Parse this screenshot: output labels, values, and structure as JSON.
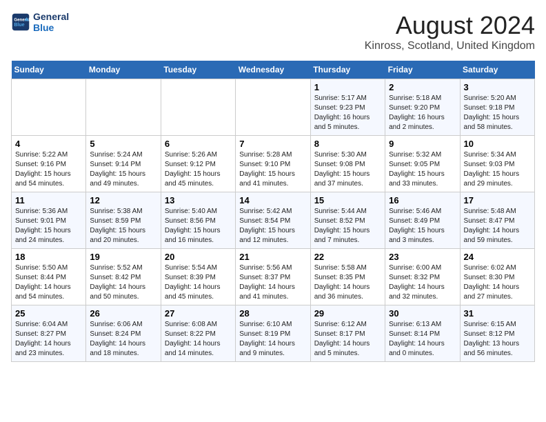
{
  "header": {
    "logo_line1": "General",
    "logo_line2": "Blue",
    "main_title": "August 2024",
    "subtitle": "Kinross, Scotland, United Kingdom"
  },
  "days_of_week": [
    "Sunday",
    "Monday",
    "Tuesday",
    "Wednesday",
    "Thursday",
    "Friday",
    "Saturday"
  ],
  "weeks": [
    [
      {
        "day": "",
        "info": ""
      },
      {
        "day": "",
        "info": ""
      },
      {
        "day": "",
        "info": ""
      },
      {
        "day": "",
        "info": ""
      },
      {
        "day": "1",
        "info": "Sunrise: 5:17 AM\nSunset: 9:23 PM\nDaylight: 16 hours\nand 5 minutes."
      },
      {
        "day": "2",
        "info": "Sunrise: 5:18 AM\nSunset: 9:20 PM\nDaylight: 16 hours\nand 2 minutes."
      },
      {
        "day": "3",
        "info": "Sunrise: 5:20 AM\nSunset: 9:18 PM\nDaylight: 15 hours\nand 58 minutes."
      }
    ],
    [
      {
        "day": "4",
        "info": "Sunrise: 5:22 AM\nSunset: 9:16 PM\nDaylight: 15 hours\nand 54 minutes."
      },
      {
        "day": "5",
        "info": "Sunrise: 5:24 AM\nSunset: 9:14 PM\nDaylight: 15 hours\nand 49 minutes."
      },
      {
        "day": "6",
        "info": "Sunrise: 5:26 AM\nSunset: 9:12 PM\nDaylight: 15 hours\nand 45 minutes."
      },
      {
        "day": "7",
        "info": "Sunrise: 5:28 AM\nSunset: 9:10 PM\nDaylight: 15 hours\nand 41 minutes."
      },
      {
        "day": "8",
        "info": "Sunrise: 5:30 AM\nSunset: 9:08 PM\nDaylight: 15 hours\nand 37 minutes."
      },
      {
        "day": "9",
        "info": "Sunrise: 5:32 AM\nSunset: 9:05 PM\nDaylight: 15 hours\nand 33 minutes."
      },
      {
        "day": "10",
        "info": "Sunrise: 5:34 AM\nSunset: 9:03 PM\nDaylight: 15 hours\nand 29 minutes."
      }
    ],
    [
      {
        "day": "11",
        "info": "Sunrise: 5:36 AM\nSunset: 9:01 PM\nDaylight: 15 hours\nand 24 minutes."
      },
      {
        "day": "12",
        "info": "Sunrise: 5:38 AM\nSunset: 8:59 PM\nDaylight: 15 hours\nand 20 minutes."
      },
      {
        "day": "13",
        "info": "Sunrise: 5:40 AM\nSunset: 8:56 PM\nDaylight: 15 hours\nand 16 minutes."
      },
      {
        "day": "14",
        "info": "Sunrise: 5:42 AM\nSunset: 8:54 PM\nDaylight: 15 hours\nand 12 minutes."
      },
      {
        "day": "15",
        "info": "Sunrise: 5:44 AM\nSunset: 8:52 PM\nDaylight: 15 hours\nand 7 minutes."
      },
      {
        "day": "16",
        "info": "Sunrise: 5:46 AM\nSunset: 8:49 PM\nDaylight: 15 hours\nand 3 minutes."
      },
      {
        "day": "17",
        "info": "Sunrise: 5:48 AM\nSunset: 8:47 PM\nDaylight: 14 hours\nand 59 minutes."
      }
    ],
    [
      {
        "day": "18",
        "info": "Sunrise: 5:50 AM\nSunset: 8:44 PM\nDaylight: 14 hours\nand 54 minutes."
      },
      {
        "day": "19",
        "info": "Sunrise: 5:52 AM\nSunset: 8:42 PM\nDaylight: 14 hours\nand 50 minutes."
      },
      {
        "day": "20",
        "info": "Sunrise: 5:54 AM\nSunset: 8:39 PM\nDaylight: 14 hours\nand 45 minutes."
      },
      {
        "day": "21",
        "info": "Sunrise: 5:56 AM\nSunset: 8:37 PM\nDaylight: 14 hours\nand 41 minutes."
      },
      {
        "day": "22",
        "info": "Sunrise: 5:58 AM\nSunset: 8:35 PM\nDaylight: 14 hours\nand 36 minutes."
      },
      {
        "day": "23",
        "info": "Sunrise: 6:00 AM\nSunset: 8:32 PM\nDaylight: 14 hours\nand 32 minutes."
      },
      {
        "day": "24",
        "info": "Sunrise: 6:02 AM\nSunset: 8:30 PM\nDaylight: 14 hours\nand 27 minutes."
      }
    ],
    [
      {
        "day": "25",
        "info": "Sunrise: 6:04 AM\nSunset: 8:27 PM\nDaylight: 14 hours\nand 23 minutes."
      },
      {
        "day": "26",
        "info": "Sunrise: 6:06 AM\nSunset: 8:24 PM\nDaylight: 14 hours\nand 18 minutes."
      },
      {
        "day": "27",
        "info": "Sunrise: 6:08 AM\nSunset: 8:22 PM\nDaylight: 14 hours\nand 14 minutes."
      },
      {
        "day": "28",
        "info": "Sunrise: 6:10 AM\nSunset: 8:19 PM\nDaylight: 14 hours\nand 9 minutes."
      },
      {
        "day": "29",
        "info": "Sunrise: 6:12 AM\nSunset: 8:17 PM\nDaylight: 14 hours\nand 5 minutes."
      },
      {
        "day": "30",
        "info": "Sunrise: 6:13 AM\nSunset: 8:14 PM\nDaylight: 14 hours\nand 0 minutes."
      },
      {
        "day": "31",
        "info": "Sunrise: 6:15 AM\nSunset: 8:12 PM\nDaylight: 13 hours\nand 56 minutes."
      }
    ]
  ]
}
